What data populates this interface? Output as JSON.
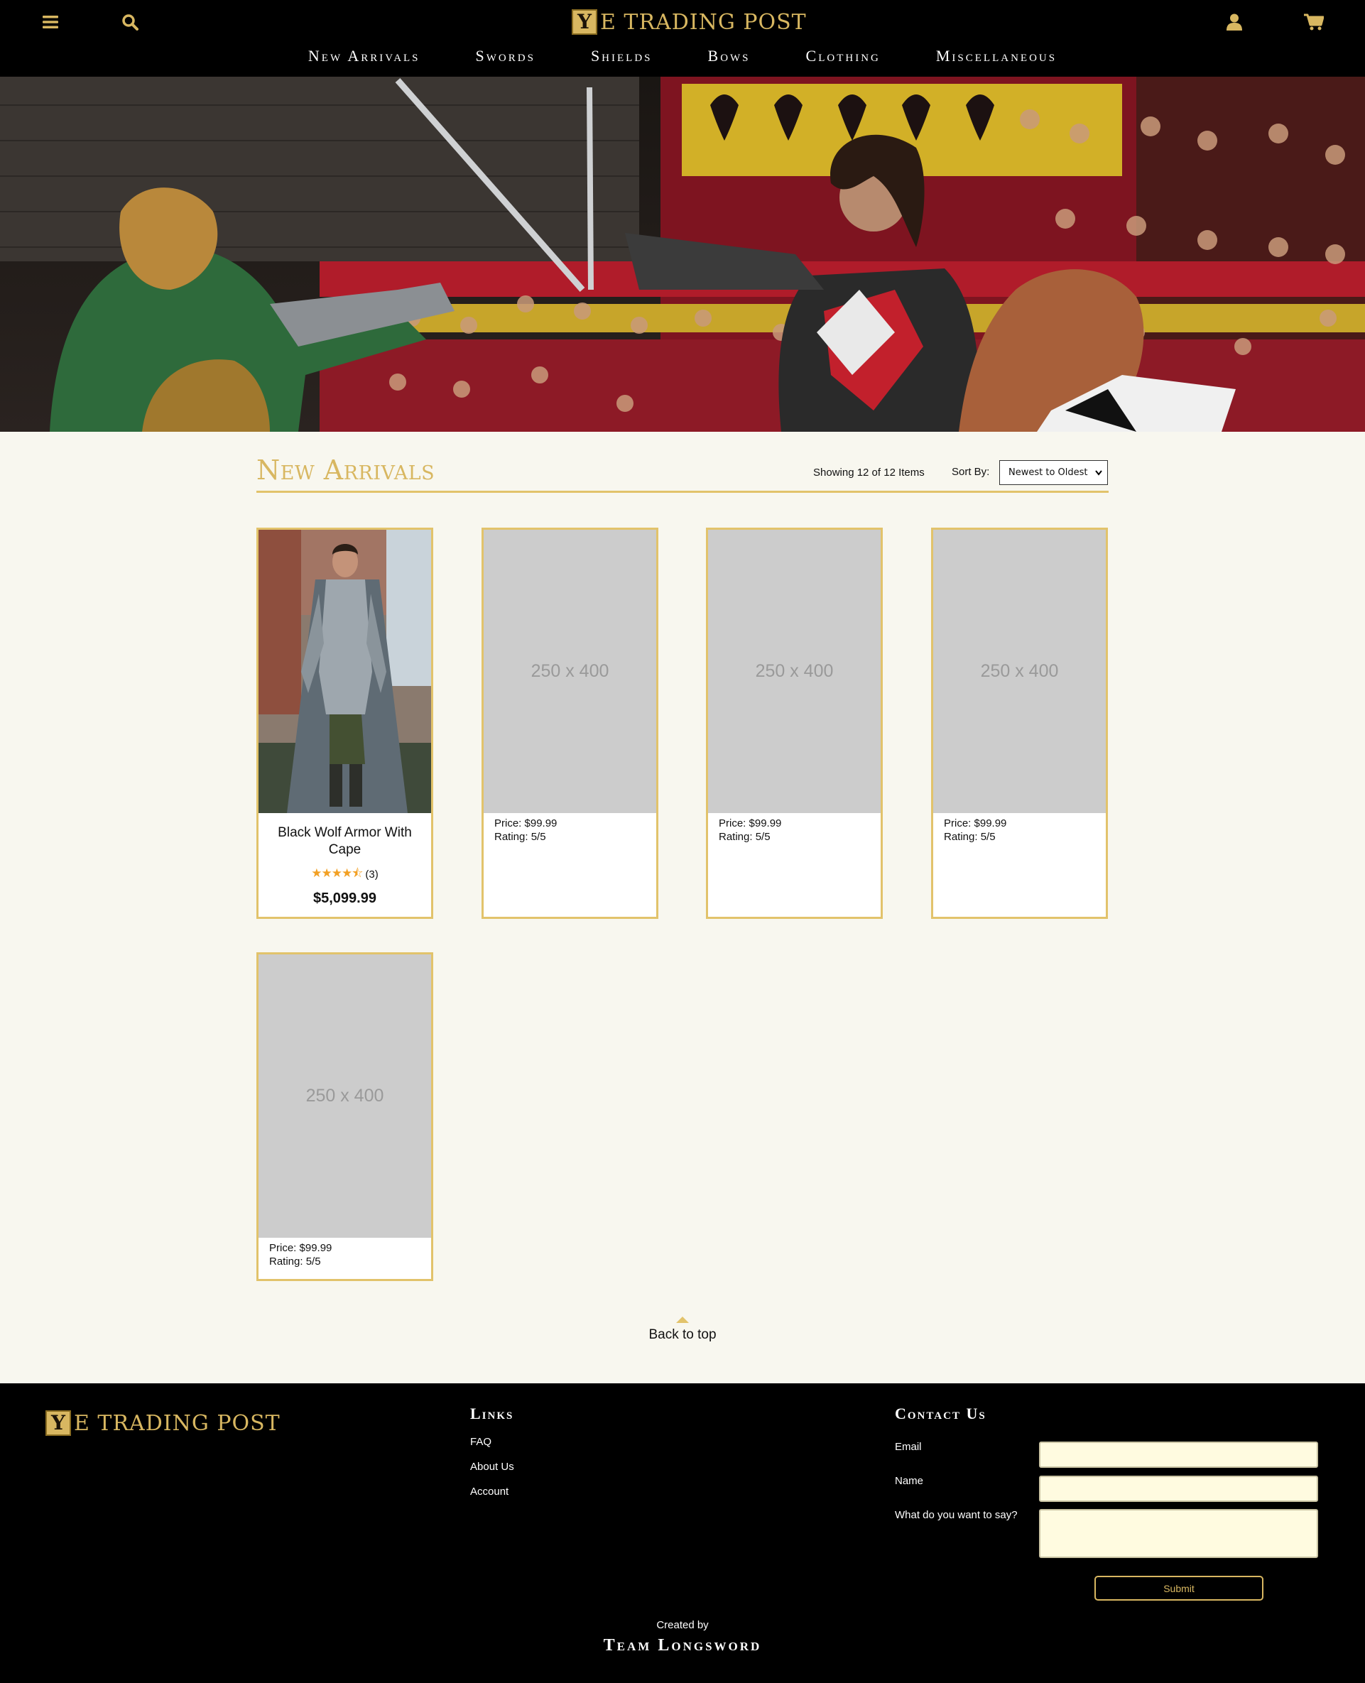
{
  "brand": {
    "logo_letter": "Y",
    "logo_text": "E TRADING POST"
  },
  "header": {
    "icons": [
      "menu-icon",
      "search-icon",
      "user-icon",
      "cart-icon"
    ]
  },
  "nav": {
    "items": [
      "New Arrivals",
      "Swords",
      "Shields",
      "Bows",
      "Clothing",
      "Miscellaneous"
    ]
  },
  "section": {
    "title": "New Arrivals",
    "showing": "Showing 12 of 12 Items",
    "sort_label": "Sort By:",
    "sort_selected": "Newest to Oldest"
  },
  "products": [
    {
      "name": "Black Wolf Armor With Cape",
      "rating_count": "(3)",
      "rating_stars": 4.5,
      "price": "$5,099.99"
    },
    {
      "image_placeholder": "250 x 400",
      "price": "Price: $99.99",
      "rating": "Rating: 5/5"
    },
    {
      "image_placeholder": "250 x 400",
      "price": "Price: $99.99",
      "rating": "Rating: 5/5"
    },
    {
      "image_placeholder": "250 x 400",
      "price": "Price: $99.99",
      "rating": "Rating: 5/5"
    },
    {
      "image_placeholder": "250 x 400",
      "price": "Price: $99.99",
      "rating": "Rating: 5/5"
    }
  ],
  "back_to_top": "Back to top",
  "footer": {
    "links_heading": "Links",
    "links": [
      "FAQ",
      "About Us",
      "Account"
    ],
    "contact_heading": "Contact Us",
    "email_label": "Email",
    "name_label": "Name",
    "message_label": "What do you want to say?",
    "submit_label": "Submit",
    "created_by": "Created by",
    "team": "Team Longsword"
  },
  "colors": {
    "gold": "#d8b761",
    "card_border": "#e2c36b",
    "page_bg": "#f8f7ef",
    "header_bg": "#000000",
    "input_bg": "#fffbe0",
    "star": "#f2a024"
  }
}
